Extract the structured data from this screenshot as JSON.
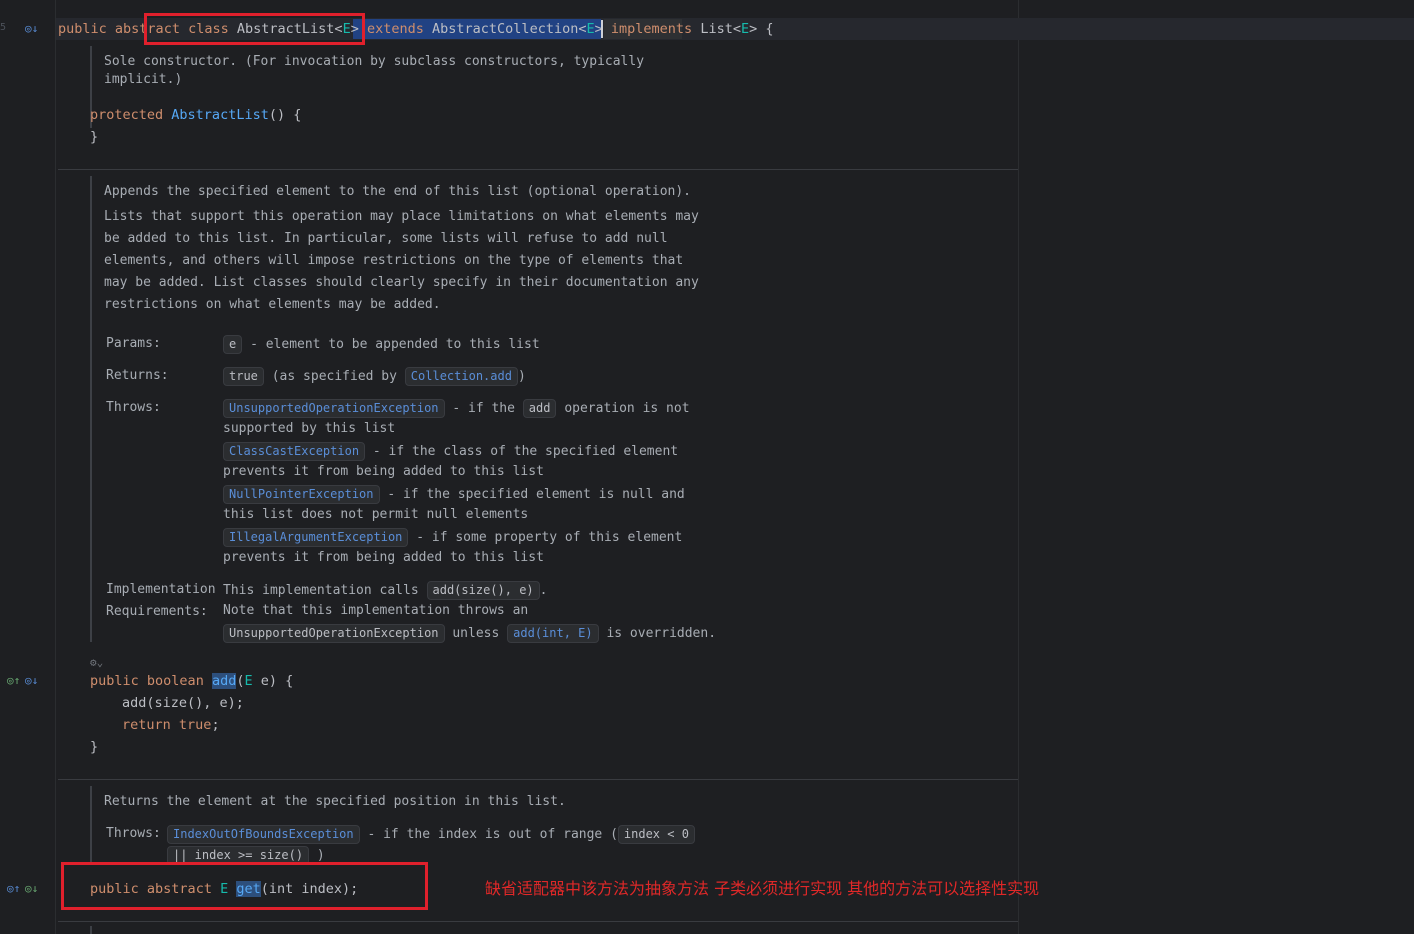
{
  "code": {
    "class_decl": {
      "public": "public",
      "abstract": "abstract",
      "class": "class",
      "name": "AbstractList",
      "lt": "<",
      "type_param": "E",
      "gt": ">",
      "extends": "extends",
      "super": "AbstractCollection",
      "implements": "implements",
      "iface": "List",
      "open": "{"
    },
    "ctor_doc": {
      "line1": "Sole constructor. (For invocation by subclass constructors, typically",
      "line2": "implicit.)"
    },
    "ctor": {
      "protected": "protected",
      "name": "AbstractList",
      "rest": "() {",
      "close": "}"
    },
    "add_doc": {
      "summary": "Appends the specified element to the end of this list (optional operation).",
      "body": [
        "Lists that support this operation may place limitations on what elements may",
        "be added to this list. In particular, some lists will refuse to add null",
        "elements, and others will impose restrictions on the type of elements that",
        "may be added. List classes should clearly specify in their documentation any",
        "restrictions on what elements may be added."
      ],
      "params_label": "Params:",
      "param_name": "e",
      "param_desc": "- element to be appended to this list",
      "returns_label": "Returns:",
      "returns_value": "true",
      "returns_pre": "(as specified by",
      "returns_link": "Collection.add",
      "returns_post": ")",
      "throws_label": "Throws:",
      "throws": [
        {
          "ex": "UnsupportedOperationException",
          "pre": "- if the",
          "code": "add",
          "post": "operation is not",
          "cont": "supported by this list"
        },
        {
          "ex": "ClassCastException",
          "pre": "- if the class of the specified element",
          "cont": "prevents it from being added to this list"
        },
        {
          "ex": "NullPointerException",
          "pre": "- if the specified element is null and",
          "cont": "this list does not permit null elements"
        },
        {
          "ex": "IllegalArgumentException",
          "pre": "- if some property of this element",
          "cont": "prevents it from being added to this list"
        }
      ],
      "impl_label_1": "Implementation",
      "impl_label_2": "Requirements:",
      "impl_line1_pre": "This implementation calls",
      "impl_line1_code": "add(size(), e)",
      "impl_line1_post": ".",
      "impl_line2": "Note that this implementation throws an",
      "impl_line3_code": "UnsupportedOperationException",
      "impl_line3_mid": "unless",
      "impl_line3_link": "add(int, E)",
      "impl_line3_post": "is overridden."
    },
    "add_method": {
      "public": "public",
      "boolean": "boolean",
      "name": "add",
      "paren": "(",
      "type": "E",
      "rest": " e) {",
      "body1": "add(size(), e);",
      "return_kw": "return",
      "return_val": "true",
      "semi": ";",
      "close": "}"
    },
    "get_doc": {
      "summary": "Returns the element at the specified position in this list.",
      "throws_label": "Throws:",
      "ex": "IndexOutOfBoundsException",
      "desc": "- if the index is out of range (",
      "cond1": "index < 0",
      "cond2": "|| index >= size()",
      "close": ")"
    },
    "get_method": {
      "public": "public",
      "abstract": "abstract",
      "type": "E",
      "name": "get",
      "rest": "(int index);"
    }
  },
  "annotation": "缺省适配器中该方法为抽象方法 子类必须进行实现 其他的方法可以选择性实现",
  "gutter": {
    "line_top": "5",
    "inline_icons": "⚙⌄"
  },
  "colors": {
    "background": "#1e1f22",
    "keyword": "#cf8e6d",
    "function": "#56a8f5",
    "type_param": "#16baac",
    "doc": "#a8adb4",
    "annotation_red": "#e02828"
  }
}
